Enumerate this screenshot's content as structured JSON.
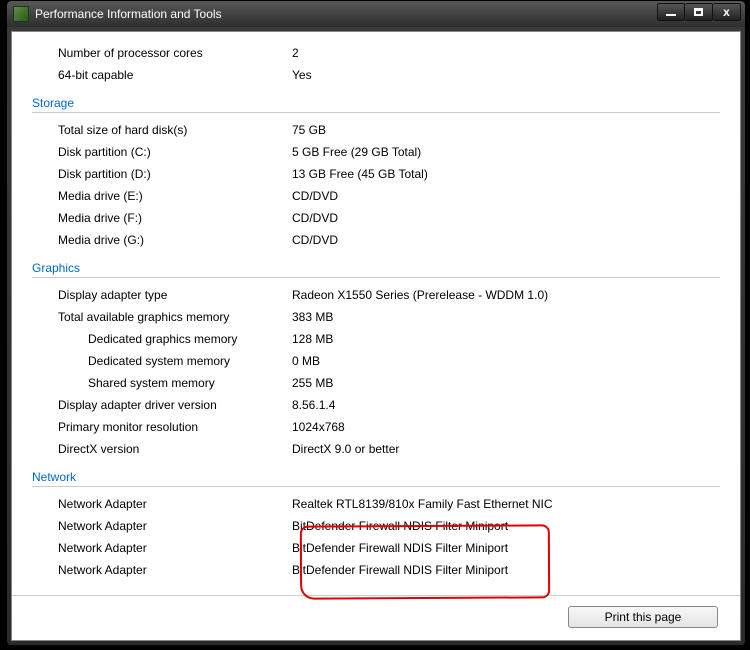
{
  "window": {
    "title": "Performance Information and Tools"
  },
  "toprows": [
    {
      "label": "Number of processor cores",
      "value": "2"
    },
    {
      "label": "64-bit capable",
      "value": "Yes"
    }
  ],
  "sections": [
    {
      "title": "Storage",
      "rows": [
        {
          "label": "Total size of hard disk(s)",
          "value": "75 GB"
        },
        {
          "label": "Disk partition (C:)",
          "value": "5 GB Free (29 GB Total)"
        },
        {
          "label": "Disk partition (D:)",
          "value": "13 GB Free (45 GB Total)"
        },
        {
          "label": "Media drive (E:)",
          "value": "CD/DVD"
        },
        {
          "label": "Media drive (F:)",
          "value": "CD/DVD"
        },
        {
          "label": "Media drive (G:)",
          "value": "CD/DVD"
        }
      ]
    },
    {
      "title": "Graphics",
      "rows": [
        {
          "label": "Display adapter type",
          "value": "Radeon X1550 Series (Prerelease - WDDM 1.0)"
        },
        {
          "label": "Total available graphics memory",
          "value": "383 MB"
        },
        {
          "label": "Dedicated graphics memory",
          "value": "128 MB",
          "indent": true
        },
        {
          "label": "Dedicated system memory",
          "value": "0 MB",
          "indent": true
        },
        {
          "label": "Shared system memory",
          "value": "255 MB",
          "indent": true
        },
        {
          "label": "Display adapter driver version",
          "value": "8.56.1.4"
        },
        {
          "label": "Primary monitor resolution",
          "value": "1024x768"
        },
        {
          "label": "DirectX version",
          "value": "DirectX 9.0 or better"
        }
      ]
    },
    {
      "title": "Network",
      "rows": [
        {
          "label": "Network Adapter",
          "value": "Realtek RTL8139/810x Family Fast Ethernet NIC"
        },
        {
          "label": "Network Adapter",
          "value": "BitDefender Firewall NDIS Filter Miniport"
        },
        {
          "label": "Network Adapter",
          "value": "BitDefender Firewall NDIS Filter Miniport"
        },
        {
          "label": "Network Adapter",
          "value": "BitDefender Firewall NDIS Filter Miniport"
        }
      ]
    }
  ],
  "buttons": {
    "print": "Print this page"
  }
}
